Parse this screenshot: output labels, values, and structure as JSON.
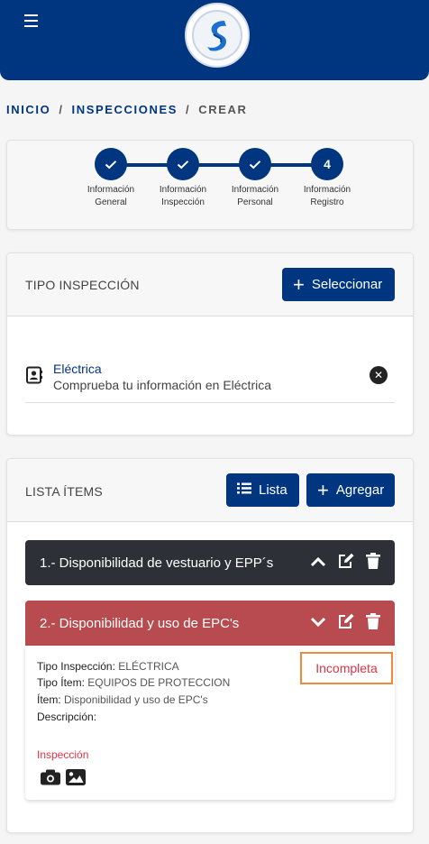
{
  "header": {
    "menu_icon": "hamburger-icon",
    "logo_icon": "brand-logo-icon"
  },
  "breadcrumb": {
    "items": [
      "INICIO",
      "INSPECCIONES",
      "CREAR"
    ],
    "separator": "/"
  },
  "stepper": {
    "steps": [
      {
        "label_line1": "Información",
        "label_line2": "General",
        "state": "done"
      },
      {
        "label_line1": "Información",
        "label_line2": "Inspección",
        "state": "done"
      },
      {
        "label_line1": "Información",
        "label_line2": "Personal",
        "state": "done"
      },
      {
        "label_line1": "Información",
        "label_line2": "Registro",
        "state": "current",
        "number": "4"
      }
    ]
  },
  "tipo": {
    "title": "TIPO INSPECCIÓN",
    "select_label": "Seleccionar",
    "item": {
      "name": "Eléctrica",
      "description": "Comprueba tu información en Eléctrica"
    }
  },
  "lista": {
    "title": "LISTA ÍTEMS",
    "list_label": "Lista",
    "add_label": "Agregar",
    "items": [
      {
        "title": "1.- Disponibilidad de vestuario y EPP´s",
        "expanded": false
      },
      {
        "title": "2.- Disponibilidad y uso de EPC's",
        "expanded": true,
        "status": "Incompleta",
        "tipo_inspeccion_label": "Tipo Inspección:",
        "tipo_inspeccion_value": "ELÉCTRICA",
        "tipo_item_label": "Tipo Ítem:",
        "tipo_item_value": "EQUIPOS DE PROTECCION",
        "item_label": "Ítem:",
        "item_value": "Disponibilidad y uso de EPC's",
        "descripcion_label": "Descripción:",
        "descripcion_value": "",
        "inspeccion_label": "Inspección"
      }
    ]
  },
  "colors": {
    "primary": "#003680",
    "danger_bar": "#b84b4f",
    "dark_bar": "#2d3137",
    "incomplete_border": "#f08a3a",
    "incomplete_text": "#dc3545"
  }
}
